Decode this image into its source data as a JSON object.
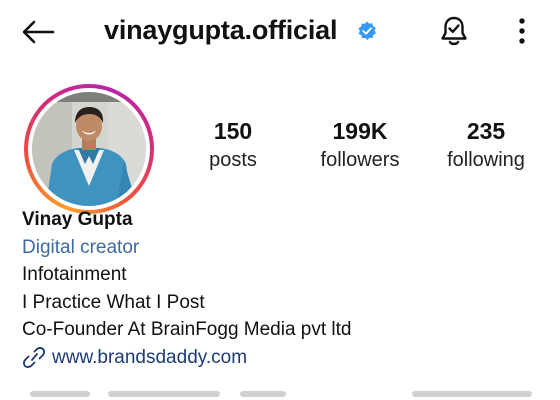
{
  "header": {
    "username": "vinaygupta.official",
    "back_icon": "arrow-left-icon",
    "verified_icon": "verified-badge-icon",
    "notification_icon": "bell-check-icon",
    "more_icon": "more-vertical-icon"
  },
  "stats": {
    "posts": {
      "value": "150",
      "label": "posts"
    },
    "followers": {
      "value": "199K",
      "label": "followers"
    },
    "following": {
      "value": "235",
      "label": "following"
    }
  },
  "bio": {
    "name": "Vinay Gupta",
    "category": "Digital creator",
    "lines": [
      "Infotainment",
      "I Practice What I Post",
      "Co-Founder At BrainFogg Media pvt ltd"
    ],
    "link": "www.brandsdaddy.com",
    "link_icon": "link-icon"
  },
  "colors": {
    "verified_blue": "#3897f0",
    "category_blue": "#3d6aa1",
    "link_blue": "#1d3a78",
    "story_ring": [
      "#f9a12c",
      "#f1503b",
      "#d5287f",
      "#b625a8"
    ]
  }
}
